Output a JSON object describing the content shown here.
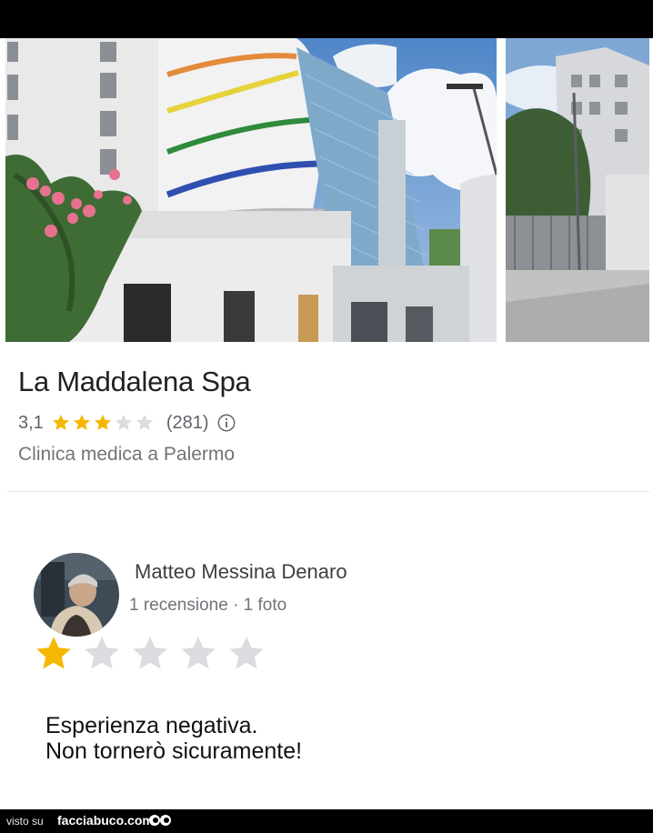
{
  "place": {
    "name": "La Maddalena Spa",
    "rating_value": "3,1",
    "rating_stars": 3,
    "review_count": "(281)",
    "category": "Clinica medica a Palermo"
  },
  "review": {
    "author": "Matteo Messina Denaro",
    "author_meta": "1 recensione · 1 foto",
    "stars": 1,
    "text_line1": "Esperienza negativa.",
    "text_line2": "Non tornerò sicuramente!"
  },
  "footer": {
    "prefix": "visto su",
    "site": "facciabuco.com"
  },
  "colors": {
    "star_filled": "#f5b800",
    "star_empty": "#dadce0",
    "text_secondary": "#70757a"
  }
}
